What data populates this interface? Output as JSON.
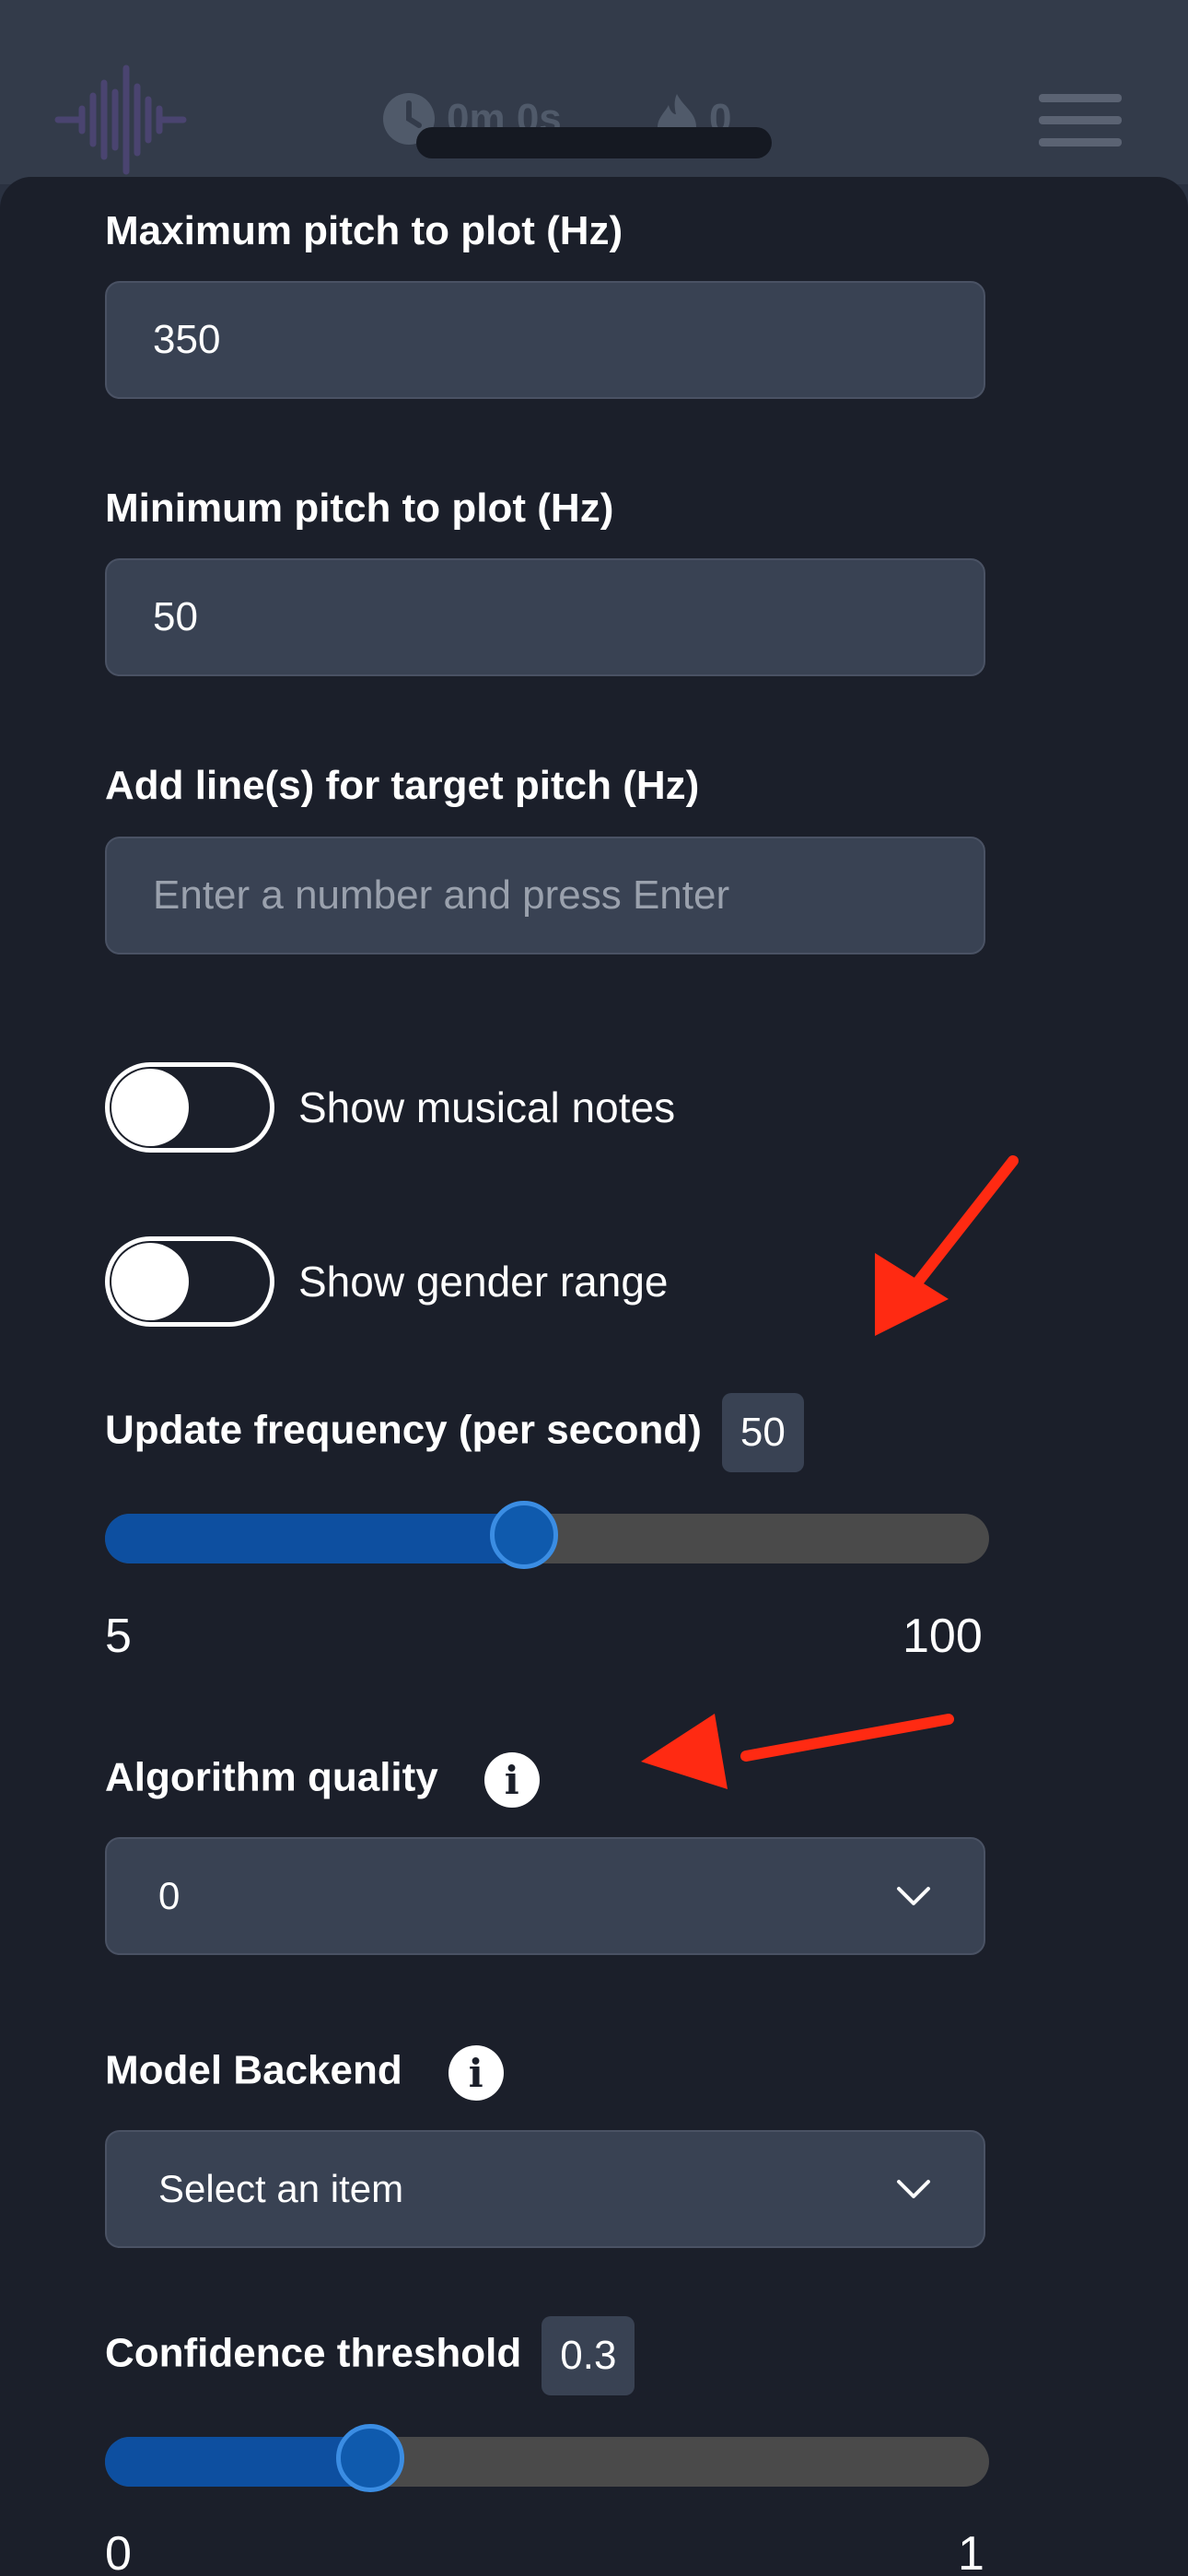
{
  "header": {
    "timer_text": "0m 0s",
    "streak_count": "0",
    "icons": [
      "waveform-logo-icon",
      "clock-icon",
      "flame-icon",
      "hamburger-menu-icon"
    ]
  },
  "settings": {
    "max_pitch": {
      "label": "Maximum pitch to plot (Hz)",
      "value": "350"
    },
    "min_pitch": {
      "label": "Minimum pitch to plot (Hz)",
      "value": "50"
    },
    "target_pitch": {
      "label": "Add line(s) for target pitch (Hz)",
      "value": "",
      "placeholder": "Enter a number and press Enter"
    },
    "show_notes": {
      "label": "Show musical notes",
      "on": false
    },
    "show_gender": {
      "label": "Show gender range",
      "on": false
    },
    "update_frequency": {
      "label": "Update frequency (per second)",
      "value": "50",
      "min": "5",
      "max": "100",
      "fraction": 0.474
    },
    "algorithm_quality": {
      "label": "Algorithm quality",
      "selected": "0"
    },
    "model_backend": {
      "label": "Model Backend",
      "selected": "Select an item"
    },
    "confidence_threshold": {
      "label": "Confidence threshold",
      "value": "0.3",
      "min": "0",
      "max": "1",
      "fraction": 0.3
    }
  },
  "colors": {
    "accent_blue": "#0d4fa0",
    "annotation_arrow": "#ff2a12",
    "sheet_background": "#1b1f2a"
  }
}
